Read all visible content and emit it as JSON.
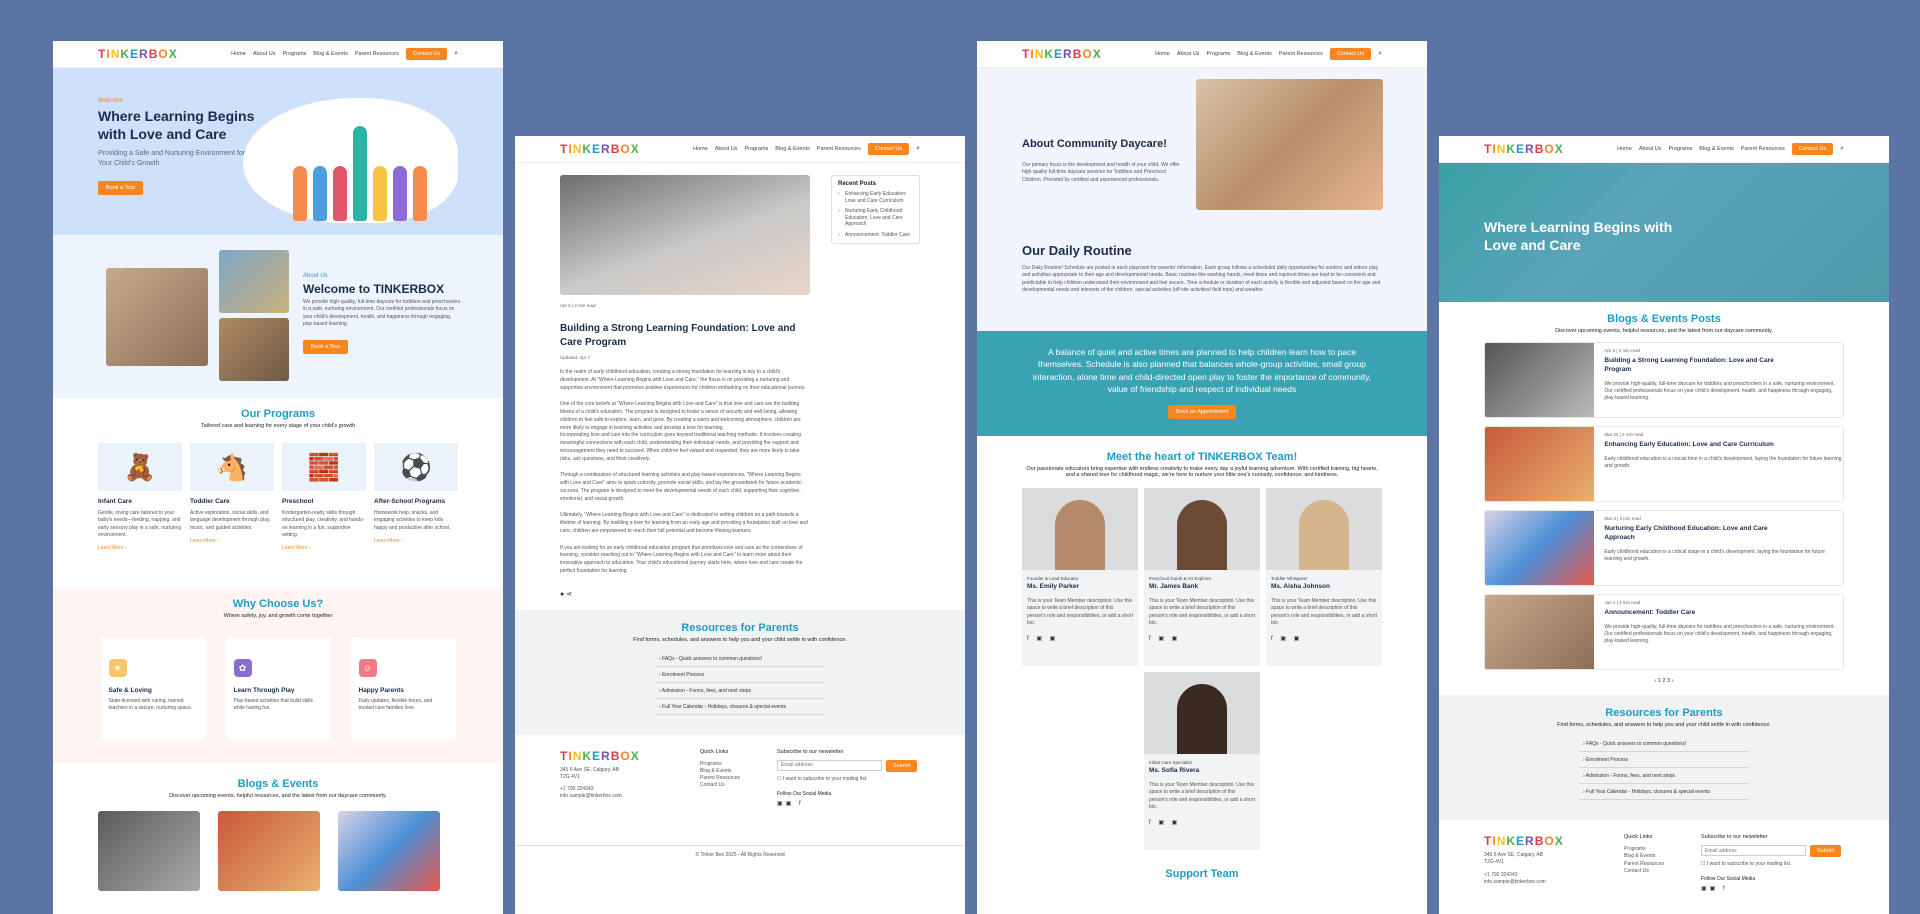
{
  "brand": {
    "logo": "TINKERBOX",
    "letters": [
      "T",
      "I",
      "N",
      "K",
      "E",
      "R",
      "B",
      "O",
      "X"
    ],
    "letter_colors": [
      "#e63946",
      "#f7861e",
      "#f4c20d",
      "#4caf50",
      "#1e9cc4",
      "#7b4fb3",
      "#e63946",
      "#f7861e",
      "#4caf50"
    ],
    "accent": "#f7861e",
    "teal": "#1e9cc4"
  },
  "nav": {
    "items": [
      "Home",
      "About Us",
      "Programs",
      "Blog & Events",
      "Parent Resources"
    ],
    "contact": "Contact Us"
  },
  "page1": {
    "hero": {
      "welcome": "Welcome",
      "title": "Where Learning Begins with Love and Care",
      "subtitle": "Providing a Safe and Nurturing Environment for Your Child's Growth",
      "button": "Book a Tour"
    },
    "about": {
      "eyebrow": "About Us",
      "title": "Welcome to TINKERBOX",
      "text": "We provide high-quality, full-time daycare for toddlers and preschoolers in a safe, nurturing environment. Our certified professionals focus on your child's development, health, and happiness through engaging, play-based learning.",
      "button": "Book a Tour"
    },
    "programs": {
      "title": "Our Programs",
      "subtitle": "Tailored care and learning for every stage of your child's growth",
      "learn": "Learn More",
      "items": [
        {
          "name": "Infant Care",
          "text": "Gentle, loving care tailored to your baby's needs—feeding, napping, and early sensory play in a safe, nurturing environment.",
          "icon": "🧸"
        },
        {
          "name": "Toddler Care",
          "text": "Active exploration, social skills, and language development through play, music, and guided activities.",
          "icon": "🐴"
        },
        {
          "name": "Preschool",
          "text": "Kindergarten-ready skills through structured play, creativity, and hands-on learning in a fun, supportive setting.",
          "icon": "🧱"
        },
        {
          "name": "After-School Programs",
          "text": "Homework help, snacks, and engaging activities to keep kids happy and productive after school.",
          "icon": "⚽"
        }
      ]
    },
    "why": {
      "title": "Why Choose Us?",
      "subtitle": "Where safety, joy, and growth come together",
      "items": [
        {
          "name": "Safe & Loving",
          "text": "State-licensed with caring, trained teachers in a secure, nurturing space.",
          "color": "#f7c66a",
          "icon": "♥"
        },
        {
          "name": "Learn Through Play",
          "text": "Play-based activities that build skills while having fun.",
          "color": "#8b6dcf",
          "icon": "✿"
        },
        {
          "name": "Happy Parents",
          "text": "Daily updates, flexible hours, and trusted care families love.",
          "color": "#f07a86",
          "icon": "☺"
        }
      ]
    },
    "blogs": {
      "title": "Blogs & Events",
      "subtitle": "Discover upcoming events, helpful resources, and the latest from our daycare community."
    }
  },
  "page2": {
    "meta": "Apr 6 | 2 min read",
    "title": "Building a Strong Learning Foundation: Love and Care Program",
    "updated": "Updated: Apr 7",
    "paragraphs": [
      "In the realm of early childhood education, creating a strong foundation for learning is key to a child's development. At \"Where Learning Begins with Love and Care,\" the focus is on providing a nurturing and supportive environment that promotes positive experiences for children embarking on their educational journey.",
      "One of the core beliefs at \"Where Learning Begins with Love and Care\" is that love and care are the building blocks of a child's education. The program is designed to foster a sense of security and well-being, allowing children to feel safe to explore, learn, and grow. By creating a warm and welcoming atmosphere, children are more likely to engage in learning activities and develop a love for learning.",
      "Incorporating love and care into the curriculum goes beyond traditional teaching methods. It involves creating meaningful connections with each child, understanding their individual needs, and providing the support and encouragement they need to succeed. When children feel valued and respected, they are more likely to take risks, ask questions, and think creatively.",
      "Through a combination of structured learning activities and play-based experiences, \"Where Learning Begins with Love and Care\" aims to spark curiosity, promote social skills, and lay the groundwork for future academic success. The program is designed to meet the developmental needs of each child, supporting their cognitive, emotional, and social growth.",
      "Ultimately, \"Where Learning Begins with Love and Care\" is dedicated to setting children on a path towards a lifetime of learning. By instilling a love for learning from an early age and providing a foundation built on love and care, children are empowered to reach their full potential and become lifelong learners.",
      "If you are looking for an early childhood education program that prioritizes love and care as the cornerstone of learning, consider reaching out to \"Where Learning Begins with Love and Care\" to learn more about their innovative approach to education. Your child's educational journey starts here, where love and care create the perfect foundation for learning."
    ],
    "recent": {
      "title": "Recent Posts",
      "items": [
        "Enhancing Early Education: Love and Care Curriculum",
        "Nurturing Early Childhood Education: Love and Care Approach",
        "Announcement: Toddler Care"
      ]
    },
    "resources": {
      "title": "Resources for Parents",
      "subtitle": "Find forms, schedules, and answers to help you and your child settle in with confidence.",
      "items": [
        "FAQs - Quick answers to common questions!",
        "Enrolment Process",
        "Admission - Forms, fees, and next steps",
        "Full Year Calendar - Holidays, closures & special events"
      ]
    },
    "footer": {
      "address": "345 6 Ave SE, Calgary, AB T2G 4V1",
      "phone": "+1 790 324343",
      "email": "info.sample@tinkerbox.com",
      "quick_title": "Quick Links",
      "quick": [
        "Programs",
        "Blog & Events",
        "Parent Resources",
        "Contact Us"
      ],
      "news_title": "Subscribe to our newsletter",
      "email_ph": "Email address",
      "submit": "Submit",
      "consent": "I want to subscribe to your mailing list.",
      "follow": "Follow Our Social Media",
      "copyright": "© Tinker Box 2025 - All Rights Reserved"
    }
  },
  "page3": {
    "about": {
      "title": "About Community Daycare!",
      "text": "Our primary focus is the development and health of your child. We offer high quality full-time daycare services for Toddlers and Preschool Children. Provided by certified and experienced professionals."
    },
    "routine": {
      "title": "Our Daily Routine",
      "text": "Our Daily Routine! Schedule are posted in each playroom for parents' information. Each group follows a scheduled daily opportunities for outdoor and indoor play and activities appropriate to their age and developmental needs. Basic routines like washing hands, meal times and nap/rest times are kept to be consistent and predictable to help children understand their environment and feel secure. Time schedule or duration of each activity is flexible and adjusted based on the age and developmental needs and interests of the children, special activities (off site activities/ field trips) and weather."
    },
    "quote": {
      "text": "A balance of quiet and active times are planned to help children learn how to pace themselves. Schedule is also planned that balances whole-group activities, small group interaction, alone time and child-directed open play to foster the importance of community, value of friendship and respect of individual needs",
      "button": "Book an Appointment"
    },
    "team": {
      "title": "Meet the heart of TINKERBOX Team!",
      "subtitle": "Our passionate educators bring expertise with endless creativity to make every day a joyful learning adventure. With certified training, big hearts, and a shared love for childhood magic, we're here to nurture your little one's curiosity, confidence, and kindness.",
      "bio": "This is your Team Member description. Use this space to write a brief description of this person's role and responsibilities, or add a short bio.",
      "members": [
        {
          "role": "Founder & Lead Educator",
          "name": "Ms. Emily Parker"
        },
        {
          "role": "Preschool Guide & Art Explorer",
          "name": "Mr. James Bank"
        },
        {
          "role": "Toddler Whisperer",
          "name": "Ms. Aisha Johnson"
        },
        {
          "role": "Infant Care Specialist",
          "name": "Ms. Sofia Rivera"
        }
      ]
    },
    "support": "Support Team"
  },
  "page4": {
    "hero": "Where Learning Begins with Love and Care",
    "title": "Blogs & Events Posts",
    "subtitle": "Discover upcoming events, helpful resources, and the latest from our daycare community.",
    "posts": [
      {
        "date": "Apr 6 | 2 min read",
        "title": "Building a Strong Learning Foundation: Love and Care Program",
        "text": "We provide high-quality, full-time daycare for toddlers and preschoolers in a safe, nurturing environment. Our certified professionals focus on your child's development, health, and happiness through engaging, play-based learning."
      },
      {
        "date": "Mar 22 | 2 min read",
        "title": "Enhancing Early Education: Love and Care Curriculum",
        "text": "Early childhood education is a crucial time in a child's development, laying the foundation for future learning and growth."
      },
      {
        "date": "Mar 3 | 3 min read",
        "title": "Nurturing Early Childhood Education: Love and Care Approach",
        "text": "Early childhood education is a critical stage in a child's development, laying the foundation for future learning and growth."
      },
      {
        "date": "Jan 4 | 3 min read",
        "title": "Announcement: Toddler Care",
        "text": "We provide high-quality, full-time daycare for toddlers and preschoolers in a safe, nurturing environment. Our certified professionals focus on your child's development, health, and happiness through engaging, play-based learning."
      }
    ],
    "pagination": "‹ 1 2 3 ›"
  }
}
